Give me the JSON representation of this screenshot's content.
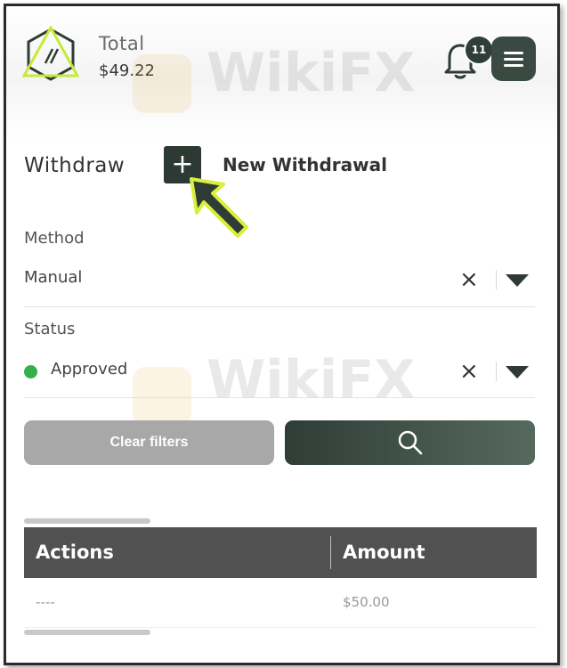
{
  "header": {
    "total_label": "Total",
    "total_value": "$49.22",
    "notification_count": "11",
    "logo_icon": "hexagon-logo-icon",
    "bell_icon": "bell-icon",
    "menu_icon": "hamburger-icon"
  },
  "withdraw": {
    "title": "Withdraw",
    "add_icon": "plus-icon",
    "new_label": "New Withdrawal"
  },
  "filters": {
    "method": {
      "label": "Method",
      "value": "Manual",
      "clear_icon": "close-icon",
      "dropdown_icon": "caret-down-icon"
    },
    "status": {
      "label": "Status",
      "value": "Approved",
      "indicator_color": "#34b04a",
      "clear_icon": "close-icon",
      "dropdown_icon": "caret-down-icon"
    },
    "clear_label": "Clear filters",
    "search_icon": "search-icon"
  },
  "table": {
    "columns": [
      "Actions",
      "Amount"
    ],
    "rows": [
      {
        "actions": "----",
        "amount": "$50.00"
      }
    ]
  },
  "watermark": "WikiFX",
  "colors": {
    "accent_dark": "#2d3a34",
    "highlight": "#d8f03c",
    "table_header": "#515151"
  }
}
